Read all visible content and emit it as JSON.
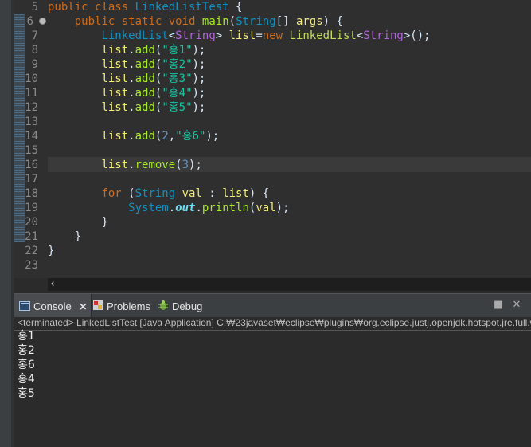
{
  "editor": {
    "line_numbers": [
      "5",
      "6",
      "7",
      "8",
      "9",
      "10",
      "11",
      "12",
      "13",
      "14",
      "15",
      "16",
      "17",
      "18",
      "19",
      "20",
      "21",
      "22",
      "23"
    ],
    "code": {
      "l5": {
        "kw1": "public",
        "kw2": "class",
        "cls": "LinkedListTest",
        "rest": " {"
      },
      "l6": {
        "kw1": "public",
        "kw2": "static",
        "kw3": "void",
        "meth": "main",
        "p1": "(",
        "typ": "String",
        "p2": "[] ",
        "var": "args",
        "p3": ") {"
      },
      "l7": {
        "typ1": "LinkedList",
        "lt": "<",
        "typ2": "String",
        "gt": ">",
        "var": "list",
        "eq": "=",
        "kw": "new",
        "typ3": "LinkedList",
        "lt2": "<",
        "typ4": "String",
        "gt2": ">",
        "end": "();"
      },
      "l8": {
        "var": "list",
        "dot": ".",
        "meth": "add",
        "p": "(",
        "str": "\"홍1\"",
        "end": ");"
      },
      "l9": {
        "var": "list",
        "dot": ".",
        "meth": "add",
        "p": "(",
        "str": "\"홍2\"",
        "end": ");"
      },
      "l10": {
        "var": "list",
        "dot": ".",
        "meth": "add",
        "p": "(",
        "str": "\"홍3\"",
        "end": ");"
      },
      "l11": {
        "var": "list",
        "dot": ".",
        "meth": "add",
        "p": "(",
        "str": "\"홍4\"",
        "end": ");"
      },
      "l12": {
        "var": "list",
        "dot": ".",
        "meth": "add",
        "p": "(",
        "str": "\"홍5\"",
        "end": ");"
      },
      "l14": {
        "var": "list",
        "dot": ".",
        "meth": "add",
        "p": "(",
        "num": "2",
        "comma": ",",
        "str": "\"홍6\"",
        "end": ");"
      },
      "l16": {
        "var": "list",
        "dot": ".",
        "meth": "remove",
        "p": "(",
        "num": "3",
        "end": ");"
      },
      "l18": {
        "kw": "for",
        "p": " (",
        "typ": "String",
        "var": "val",
        "colon": " : ",
        "var2": "list",
        "end": ") {"
      },
      "l19": {
        "sys": "System",
        "dot": ".",
        "field": "out",
        "dot2": ".",
        "meth": "println",
        "p": "(",
        "var": "val",
        "end": ");"
      },
      "l20": {
        "text": "}"
      },
      "l21": {
        "text": "}"
      },
      "l22": {
        "text": "}"
      }
    },
    "scroll_left_arrow": "‹"
  },
  "console": {
    "tabs": [
      {
        "label": "Console",
        "close": "✕"
      },
      {
        "label": "Problems"
      },
      {
        "label": "Debug"
      }
    ],
    "minimize": "■",
    "close": "✕",
    "status": "<terminated> LinkedListTest [Java Application] C:₩23javaset₩eclipse₩plugins₩org.eclipse.justj.openjdk.hotspot.jre.full.w",
    "output": [
      "홍1",
      "홍2",
      "홍6",
      "홍4",
      "홍5"
    ]
  },
  "colors": {
    "keyword": "#cc6c1d",
    "type": "#1290c3",
    "method": "#a7ec21",
    "string": "#17c6a3",
    "variable": "#f3ec79",
    "background": "#2f2f2f"
  }
}
